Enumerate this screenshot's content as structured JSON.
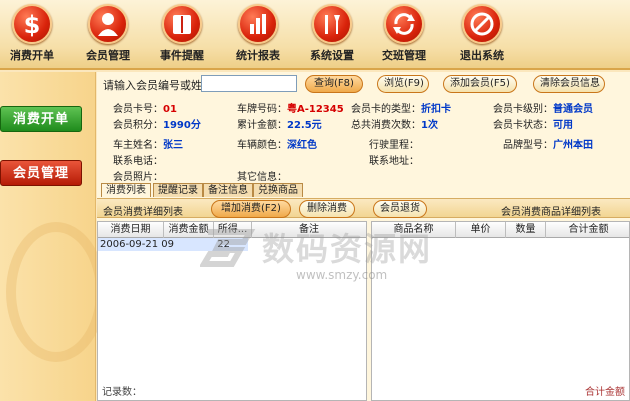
{
  "toolbar": {
    "items": [
      {
        "label": "消费开单",
        "icon": "dollar-icon"
      },
      {
        "label": "会员管理",
        "icon": "member-icon"
      },
      {
        "label": "事件提醒",
        "icon": "book-icon"
      },
      {
        "label": "统计报表",
        "icon": "bar-chart-icon"
      },
      {
        "label": "系统设置",
        "icon": "tools-icon"
      },
      {
        "label": "交班管理",
        "icon": "refresh-icon"
      },
      {
        "label": "退出系统",
        "icon": "stop-icon"
      }
    ]
  },
  "sidebar": {
    "buttons": [
      "消费开单",
      "会员管理"
    ]
  },
  "search": {
    "label": "请输入会员编号或姓名",
    "value": "",
    "query_btn": "查询(F8)",
    "browse_btn": "浏览(F9)",
    "add_btn": "添加会员(F5)",
    "clear_btn": "清除会员信息"
  },
  "member": {
    "card_no_label": "会员卡号：",
    "card_no": "01",
    "plate_label": "车牌号码：",
    "plate": "粤A-12345",
    "card_type_label": "会员卡的类型：",
    "card_type": "折扣卡",
    "level_label": "会员卡级别：",
    "level": "普通会员",
    "points_label": "会员积分：",
    "points": "1990分",
    "total_label": "累计金额：",
    "total": "22.5元",
    "visits_label": "总共消费次数：",
    "visits": "1次",
    "status_label": "会员卡状态：",
    "status": "可用",
    "owner_label": "车主姓名：",
    "owner": "张三",
    "color_label": "车辆颜色：",
    "color": "深红色",
    "mileage_label": "行驶里程：",
    "mileage": "",
    "brand_label": "品牌型号：",
    "brand": "广州本田",
    "phone_label": "联系电话：",
    "phone": "",
    "address_label": "联系地址：",
    "address": "",
    "photo_label": "会员照片：",
    "photo": "",
    "other_label": "其它信息：",
    "other": ""
  },
  "tabs": [
    "消费列表",
    "提醒记录",
    "备注信息",
    "兑换商品"
  ],
  "subbar": {
    "left_title": "会员消费详细列表",
    "add_btn": "增加消费(F2)",
    "delete_btn": "删除消费",
    "return_btn": "会员退货",
    "right_title": "会员消费商品详细列表"
  },
  "left_grid": {
    "headers": [
      "消费日期",
      "消费金额",
      "所得...",
      "备注"
    ],
    "row": {
      "date": "2006-09-21 09",
      "amount": "22"
    },
    "footer": "记录数："
  },
  "right_grid": {
    "headers": [
      "商品名称",
      "单价",
      "数量",
      "合计金额"
    ],
    "footer": "合计金额"
  },
  "watermark": {
    "text": "数码资源网",
    "url": "www.smzy.com"
  }
}
